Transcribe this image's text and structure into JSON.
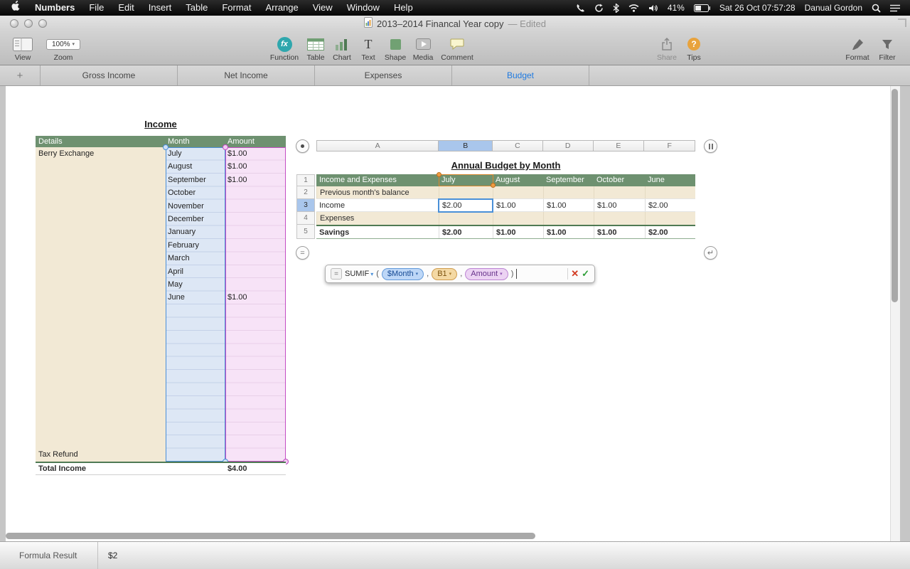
{
  "menubar": {
    "app_name": "Numbers",
    "menus": [
      "File",
      "Edit",
      "Insert",
      "Table",
      "Format",
      "Arrange",
      "View",
      "Window",
      "Help"
    ],
    "battery_pct": "41%",
    "clock": "Sat 26 Oct 07:57:28",
    "user": "Danual Gordon"
  },
  "titlebar": {
    "title": "2013–2014 Financal Year copy",
    "edited_suffix": "— Edited"
  },
  "toolbar": {
    "view": "View",
    "zoom_value": "100%",
    "zoom": "Zoom",
    "function": "Function",
    "table": "Table",
    "chart": "Chart",
    "text": "Text",
    "shape": "Shape",
    "media": "Media",
    "comment": "Comment",
    "share": "Share",
    "tips": "Tips",
    "format": "Format",
    "filter": "Filter"
  },
  "icons": {
    "fx_glyph": "fx",
    "text_tool_glyph": "T",
    "tips_glyph": "?",
    "dropdown_arrow": "▾",
    "add_sheet": "+",
    "equals_glyph": "=",
    "return_glyph": "↵",
    "cancel_glyph": "✕",
    "accept_glyph": "✓"
  },
  "sheet_tabs": {
    "tabs": [
      {
        "label": "Gross Income",
        "active": false
      },
      {
        "label": "Net Income",
        "active": false
      },
      {
        "label": "Expenses",
        "active": false
      },
      {
        "label": "Budget",
        "active": true
      }
    ]
  },
  "income_table": {
    "title": "Income",
    "headers": {
      "details": "Details",
      "month": "Month",
      "amount": "Amount"
    },
    "rows": [
      {
        "details": "Berry Exchange",
        "month": "July",
        "amount": "$1.00"
      },
      {
        "month": "August",
        "amount": "$1.00"
      },
      {
        "month": "September",
        "amount": "$1.00"
      },
      {
        "month": "October",
        "amount": ""
      },
      {
        "month": "November",
        "amount": ""
      },
      {
        "month": "December",
        "amount": ""
      },
      {
        "month": "January",
        "amount": ""
      },
      {
        "month": "February",
        "amount": ""
      },
      {
        "month": "March",
        "amount": ""
      },
      {
        "month": "April",
        "amount": ""
      },
      {
        "month": "May",
        "amount": ""
      },
      {
        "month": "June",
        "amount": "$1.00"
      }
    ],
    "tax_refund": "Tax Refund",
    "total_label": "Total Income",
    "total_amount": "$4.00"
  },
  "budget_table": {
    "title": "Annual Budget by Month",
    "column_letters": [
      "A",
      "B",
      "C",
      "D",
      "E",
      "F"
    ],
    "row_numbers": [
      "1",
      "2",
      "3",
      "4",
      "5"
    ],
    "header_row": [
      "Income and Expenses",
      "July",
      "August",
      "September",
      "October",
      "June"
    ],
    "rows": [
      {
        "label": "Previous month's balance",
        "values": [
          "",
          "",
          "",
          "",
          ""
        ]
      },
      {
        "label": "Income",
        "values": [
          "$2.00",
          "$1.00",
          "$1.00",
          "$1.00",
          "$2.00"
        ]
      },
      {
        "label": "Expenses",
        "values": [
          "",
          "",
          "",
          "",
          ""
        ]
      },
      {
        "label": "Savings",
        "values": [
          "$2.00",
          "$1.00",
          "$1.00",
          "$1.00",
          "$2.00"
        ]
      }
    ]
  },
  "formula_editor": {
    "function_name": "SUMIF",
    "open_paren": "(",
    "close_paren": ")",
    "comma": ",",
    "args": [
      {
        "text": "$Month"
      },
      {
        "text": "B1"
      },
      {
        "text": "Amount"
      }
    ]
  },
  "status_bar": {
    "label": "Formula Result",
    "value": "$2"
  }
}
